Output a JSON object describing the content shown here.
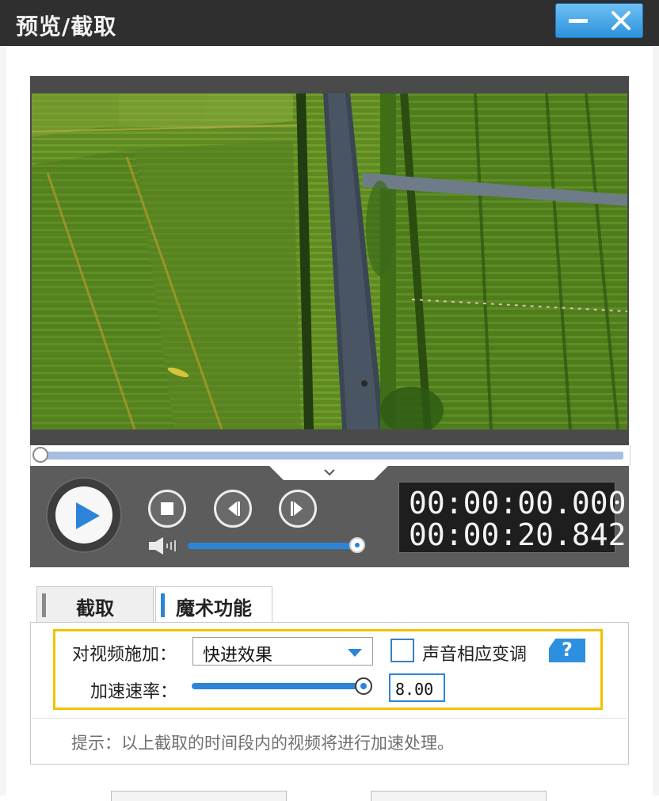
{
  "window": {
    "title": "预览/截取",
    "accent_color": "#2d92dc"
  },
  "player": {
    "current_time": "00:00:00.000",
    "total_duration": "00:00:20.842",
    "progress": 0,
    "volume": 1.0,
    "icons": [
      "play-icon",
      "stop-icon",
      "prev-frame-icon",
      "next-frame-icon",
      "volume-icon",
      "collapse-chevron-icon"
    ]
  },
  "tabs": [
    {
      "label": "截取",
      "active": false
    },
    {
      "label": "魔术功能",
      "active": true
    }
  ],
  "magic": {
    "apply_label": "对视频施加：",
    "effect_value": "快进效果",
    "pitch_checkbox_label": "声音相应变调",
    "pitch_checked": false,
    "help_label": "?",
    "speed_label": "加速速率：",
    "speed_value": "8.00",
    "speed_slider_level": 1.0,
    "highlight_color": "#f2c200",
    "hint": "提示：以上截取的时间段内的视频将进行加速处理。"
  }
}
